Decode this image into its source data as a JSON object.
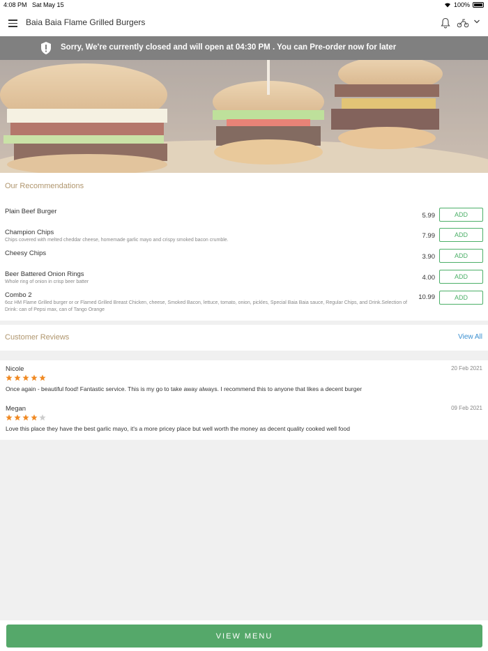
{
  "status_bar": {
    "time": "4:08 PM",
    "date": "Sat May 15",
    "battery": "100%"
  },
  "header": {
    "title": "Baia Baia Flame Grilled Burgers"
  },
  "closed_banner": {
    "message": "Sorry, We're currently closed and will open at 04:30 PM . You can Pre-order now for later"
  },
  "recommendations": {
    "title": "Our Recommendations",
    "add_label": "ADD",
    "items": [
      {
        "name": "Plain Beef Burger",
        "description": "",
        "price": "5.99"
      },
      {
        "name": "Champion Chips",
        "description": "Chips covered with melted cheddar cheese, homemade garlic mayo and crispy smoked bacon crumble.",
        "price": "7.99"
      },
      {
        "name": "Cheesy Chips",
        "description": "",
        "price": "3.90"
      },
      {
        "name": "Beer Battered Onion Rings",
        "description": "Whole ring of onion in crisp beer batter",
        "price": "4.00"
      },
      {
        "name": "Combo 2",
        "description": "6oz HM Flame Grilled burger or  or Flamed Grilled Breast Chicken, cheese, Smoked Bacon, lettuce, tomato, onion, pickles, Special Baia Baia sauce, Regular Chips, and Drink.Selection of Drink: can of Pepsi max, can of Tango Orange",
        "price": "10.99"
      }
    ]
  },
  "reviews": {
    "title": "Customer Reviews",
    "view_all": "View All",
    "items": [
      {
        "name": "Nicole",
        "date": "20 Feb 2021",
        "rating": 5,
        "text": "Once again - beautiful food! Fantastic service. This is my go to take away always. I recommend this to anyone that likes a decent burger"
      },
      {
        "name": "Megan",
        "date": "09 Feb 2021",
        "rating": 4,
        "text": "Love this place they have the best garlic mayo, it's a more pricey place but well worth the money as decent quality cooked well food"
      }
    ]
  },
  "footer": {
    "view_menu": "VIEW MENU"
  },
  "colors": {
    "accent_green": "#55a86a",
    "section_title": "#b0966e",
    "link_blue": "#3a8fd0",
    "star": "#f08a24",
    "banner_gray": "#808080"
  }
}
